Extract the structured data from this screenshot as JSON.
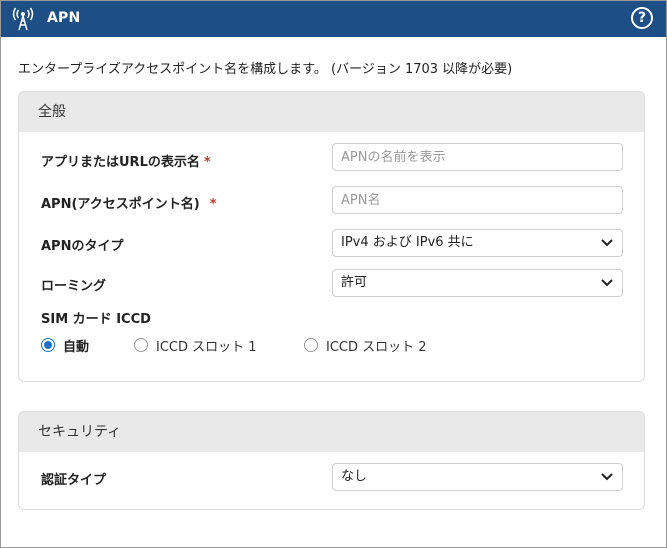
{
  "header": {
    "title": "APN",
    "app_icon": "antenna-icon",
    "help_icon": "help-circle-icon",
    "help_glyph": "?",
    "bg_color": "#1d4f86"
  },
  "description": "エンタープライズアクセスポイント名を構成します。 (バージョン 1703 以降が必要)",
  "general": {
    "header": "全般",
    "display_name": {
      "label": "アプリまたはURLの表示名",
      "required": "*",
      "placeholder": "APNの名前を表示",
      "value": ""
    },
    "apn": {
      "label": "APN(アクセスポイント名)",
      "required": "*",
      "placeholder": "APN名",
      "value": ""
    },
    "apn_type": {
      "label": "APNのタイプ",
      "value": "IPv4 および IPv6 共に"
    },
    "roaming": {
      "label": "ローミング",
      "value": "許可"
    },
    "sim_iccd": {
      "label": "SIM カード ICCD",
      "options": [
        {
          "label": "自動",
          "selected": true
        },
        {
          "label": "ICCD スロット 1",
          "selected": false
        },
        {
          "label": "ICCD スロット 2",
          "selected": false
        }
      ]
    }
  },
  "security": {
    "header": "セキュリティ",
    "auth_type": {
      "label": "認証タイプ",
      "value": "なし"
    }
  },
  "colors": {
    "accent": "#1a73c8",
    "required": "#c0392b",
    "section_bg": "#e9e9e9"
  }
}
